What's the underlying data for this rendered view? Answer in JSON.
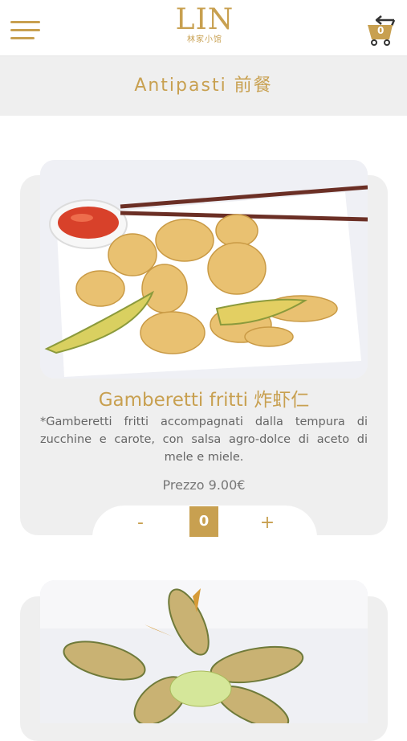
{
  "header": {
    "logo_text": "LIN",
    "logo_subtitle": "林家小馆",
    "cart_count": "0",
    "menu_icon": "hamburger-menu-icon",
    "cart_icon": "shopping-cart-icon"
  },
  "category": {
    "title": "Antipasti 前餐"
  },
  "dishes": [
    {
      "title": "Gamberetti fritti 炸虾仁",
      "description_lines": [
        "*Gamberetti fritti accompagnati dalla tempura di",
        "zucchine e carote, con salsa agro-dolce di aceto di",
        "mele e miele."
      ],
      "price": "Prezzo 9.00€",
      "minus_label": "-",
      "quantity": "0",
      "plus_label": "+"
    }
  ],
  "colors": {
    "accent": "#c8a050",
    "band": "#efefef",
    "text": "#666666"
  }
}
